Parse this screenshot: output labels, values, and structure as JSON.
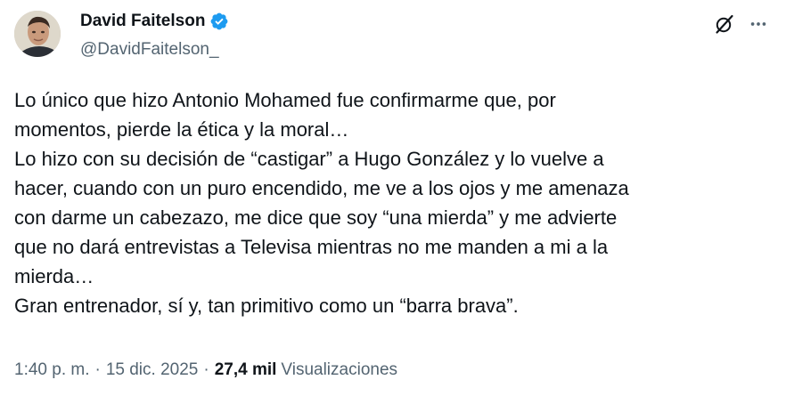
{
  "author": {
    "display_name": "David Faitelson",
    "handle": "@DavidFaitelson_",
    "verified": true
  },
  "icons": {
    "verified": "verified-badge-icon",
    "grok": "grok-icon",
    "more": "more-options-icon"
  },
  "colors": {
    "verified": "#1d9bf0",
    "text": "#0f1419",
    "secondary": "#536471"
  },
  "tweet": {
    "lines": [
      "Lo único que hizo Antonio Mohamed fue confirmarme que, por",
      "momentos, pierde la ética y la moral…",
      "Lo hizo con su decisión de “castigar” a Hugo González y lo vuelve a",
      "hacer, cuando con un puro encendido, me ve a los ojos y me amenaza",
      "con darme un cabezazo, me dice que soy “una mierda” y me advierte",
      "que no dará entrevistas a Televisa mientras no me manden a mi a la",
      "mierda…",
      "Gran entrenador, sí y, tan primitivo como un “barra brava”."
    ]
  },
  "meta": {
    "time": "1:40 p. m.",
    "separator": "·",
    "date": "15 dic. 2025",
    "views_count": "27,4 mil",
    "views_label": "Visualizaciones"
  }
}
